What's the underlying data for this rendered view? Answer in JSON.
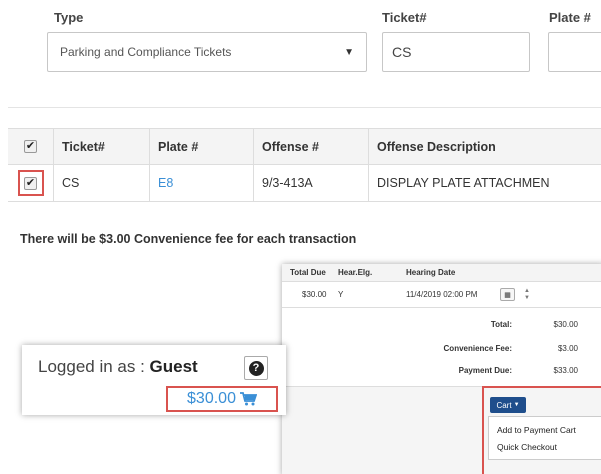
{
  "search": {
    "type_label": "Type",
    "type_value": "Parking and Compliance Tickets",
    "ticket_label": "Ticket#",
    "ticket_value": "CS",
    "plate_label": "Plate #",
    "plate_value": ""
  },
  "results": {
    "columns": [
      "Ticket#",
      "Plate #",
      "Offense #",
      "Offense Description"
    ],
    "rows": [
      {
        "checked": true,
        "ticket": "CS",
        "plate": "E8",
        "offense": "9/3-413A",
        "description": "DISPLAY PLATE ATTACHMEN"
      }
    ],
    "header_checked": true
  },
  "fee_note": "There will be $3.00 Convenience fee for each transaction",
  "cart_table": {
    "columns": [
      "Total Due",
      "Hear.Elg.",
      "Hearing Date"
    ],
    "row": {
      "total_due": "$30.00",
      "hear_elg": "Y",
      "hearing_date": "11/4/2019 02:00 PM"
    },
    "summary": [
      {
        "label": "Total:",
        "value": "$30.00"
      },
      {
        "label": "Convenience Fee:",
        "value": "$3.00"
      },
      {
        "label": "Payment Due:",
        "value": "$33.00"
      }
    ]
  },
  "cart_menu": {
    "button_label": "Cart",
    "items": [
      "Add to Payment Cart",
      "Quick Checkout"
    ]
  },
  "login": {
    "prefix": "Logged in as : ",
    "user": "Guest",
    "cart_amount": "$30.00"
  },
  "colors": {
    "highlight": "#d9534f",
    "link": "#3a8fd6",
    "cart_button": "#1f4e8c"
  },
  "icons": [
    "caret-down-icon",
    "checkbox-icon",
    "calendar-icon",
    "spinner-icon",
    "help-icon",
    "shopping-cart-icon"
  ]
}
